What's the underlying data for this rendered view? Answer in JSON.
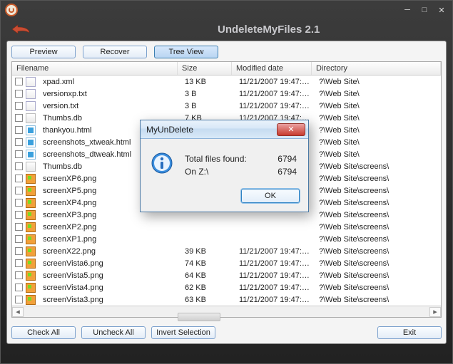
{
  "app": {
    "title": "UndeleteMyFiles 2.1"
  },
  "tabs": {
    "preview": "Preview",
    "recover": "Recover",
    "treeview": "Tree View"
  },
  "columns": {
    "name": "Filename",
    "size": "Size",
    "date": "Modified date",
    "dir": "Directory"
  },
  "rows": [
    {
      "icon": "txt",
      "name": "xpad.xml",
      "size": "13 KB",
      "date": "11/21/2007 19:47:…",
      "dir": "?\\Web Site\\"
    },
    {
      "icon": "txt",
      "name": "versionxp.txt",
      "size": "3 B",
      "date": "11/21/2007 19:47:…",
      "dir": "?\\Web Site\\"
    },
    {
      "icon": "txt",
      "name": "version.txt",
      "size": "3 B",
      "date": "11/21/2007 19:47:…",
      "dir": "?\\Web Site\\"
    },
    {
      "icon": "db",
      "name": "Thumbs.db",
      "size": "7 KB",
      "date": "11/21/2007 19:47:…",
      "dir": "?\\Web Site\\"
    },
    {
      "icon": "html",
      "name": "thankyou.html",
      "size": "",
      "date": "",
      "dir": "?\\Web Site\\"
    },
    {
      "icon": "html",
      "name": "screenshots_xtweak.html",
      "size": "",
      "date": "",
      "dir": "?\\Web Site\\"
    },
    {
      "icon": "html",
      "name": "screenshots_dtweak.html",
      "size": "",
      "date": "",
      "dir": "?\\Web Site\\"
    },
    {
      "icon": "db",
      "name": "Thumbs.db",
      "size": "",
      "date": "",
      "dir": "?\\Web Site\\screens\\"
    },
    {
      "icon": "png",
      "name": "screenXP6.png",
      "size": "",
      "date": "",
      "dir": "?\\Web Site\\screens\\"
    },
    {
      "icon": "png",
      "name": "screenXP5.png",
      "size": "",
      "date": "",
      "dir": "?\\Web Site\\screens\\"
    },
    {
      "icon": "png",
      "name": "screenXP4.png",
      "size": "",
      "date": "",
      "dir": "?\\Web Site\\screens\\"
    },
    {
      "icon": "png",
      "name": "screenXP3.png",
      "size": "",
      "date": "",
      "dir": "?\\Web Site\\screens\\"
    },
    {
      "icon": "png",
      "name": "screenXP2.png",
      "size": "",
      "date": "",
      "dir": "?\\Web Site\\screens\\"
    },
    {
      "icon": "png",
      "name": "screenXP1.png",
      "size": "",
      "date": "",
      "dir": "?\\Web Site\\screens\\"
    },
    {
      "icon": "png",
      "name": "screenX22.png",
      "size": "39 KB",
      "date": "11/21/2007 19:47:…",
      "dir": "?\\Web Site\\screens\\"
    },
    {
      "icon": "png",
      "name": "screenVista6.png",
      "size": "74 KB",
      "date": "11/21/2007 19:47:…",
      "dir": "?\\Web Site\\screens\\"
    },
    {
      "icon": "png",
      "name": "screenVista5.png",
      "size": "64 KB",
      "date": "11/21/2007 19:47:…",
      "dir": "?\\Web Site\\screens\\"
    },
    {
      "icon": "png",
      "name": "screenVista4.png",
      "size": "62 KB",
      "date": "11/21/2007 19:47:…",
      "dir": "?\\Web Site\\screens\\"
    },
    {
      "icon": "png",
      "name": "screenVista3.png",
      "size": "63 KB",
      "date": "11/21/2007 19:47:…",
      "dir": "?\\Web Site\\screens\\"
    }
  ],
  "buttons": {
    "check_all": "Check All",
    "uncheck_all": "Uncheck All",
    "invert": "Invert Selection",
    "exit": "Exit"
  },
  "dialog": {
    "title": "MyUnDelete",
    "line1_label": "Total files found:",
    "line1_value": "6794",
    "line2_label": "On Z:\\",
    "line2_value": "6794",
    "ok": "OK"
  }
}
